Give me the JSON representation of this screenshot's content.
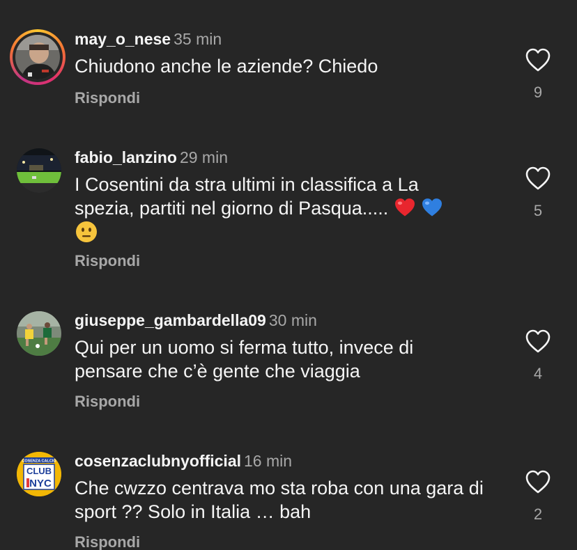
{
  "comments": [
    {
      "username": "may_o_nese",
      "time": "35 min",
      "text": "Chiudono anche le aziende? Chiedo",
      "reply": "Rispondi",
      "likes": "9"
    },
    {
      "username": "fabio_lanzino",
      "time": "29 min",
      "text_line1": "I Cosentini da stra ultimi in classifica a La",
      "text_line2": "spezia, partiti nel giorno di Pasqua.....",
      "reply": "Rispondi",
      "likes": "5"
    },
    {
      "username": "giuseppe_gambardella09",
      "time": "30 min",
      "text": "Qui per un uomo si ferma tutto, invece di pensare che c’è gente che viaggia",
      "reply": "Rispondi",
      "likes": "4"
    },
    {
      "username": "cosenzaclubnyofficial",
      "time": "16 min",
      "text": "Che cwzzo centrava mo sta roba con una gara di sport ?? Solo in Italia … bah",
      "reply": "Rispondi",
      "likes": "2",
      "avatar_text_top": "COSENZA CALCIO",
      "avatar_text_club": "CLUB",
      "avatar_text_nyc": "NYC"
    }
  ],
  "colors": {
    "background": "#262626",
    "primary_text": "#f5f5f5",
    "secondary_text": "#a8a8a8",
    "heart_red": "#e8262e",
    "heart_blue": "#2f7fe0"
  }
}
